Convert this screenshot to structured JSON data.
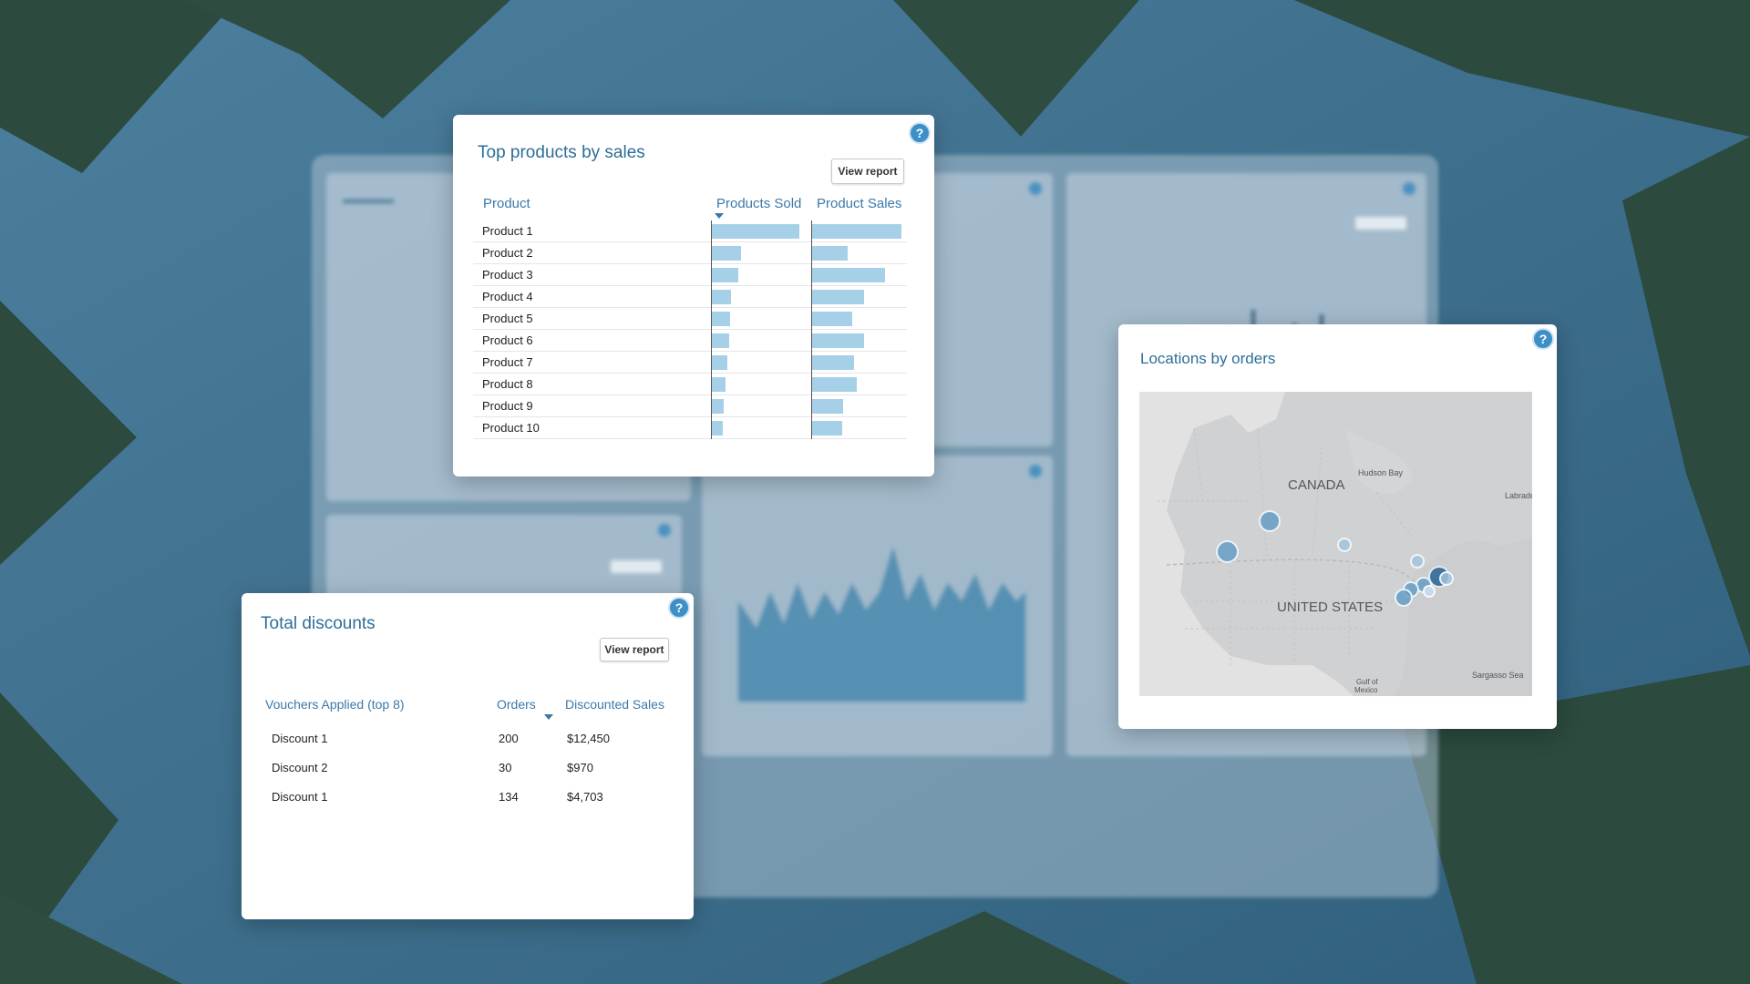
{
  "top_products": {
    "title": "Top products by sales",
    "view_report": "View report",
    "help": "?",
    "columns": {
      "product": "Product",
      "sold": "Products Sold",
      "sales": "Product Sales"
    },
    "rows": [
      {
        "name": "Product 1",
        "sold": 1.0,
        "sales": 1.0
      },
      {
        "name": "Product 2",
        "sold": 0.33,
        "sales": 0.4
      },
      {
        "name": "Product 3",
        "sold": 0.3,
        "sales": 0.82
      },
      {
        "name": "Product 4",
        "sold": 0.22,
        "sales": 0.58
      },
      {
        "name": "Product 5",
        "sold": 0.21,
        "sales": 0.45
      },
      {
        "name": "Product 6",
        "sold": 0.2,
        "sales": 0.58
      },
      {
        "name": "Product 7",
        "sold": 0.18,
        "sales": 0.47
      },
      {
        "name": "Product 8",
        "sold": 0.16,
        "sales": 0.5
      },
      {
        "name": "Product 9",
        "sold": 0.14,
        "sales": 0.35
      },
      {
        "name": "Product 10",
        "sold": 0.13,
        "sales": 0.34
      }
    ]
  },
  "total_discounts": {
    "title": "Total discounts",
    "view_report": "View report",
    "help": "?",
    "columns": {
      "voucher": "Vouchers Applied (top 8)",
      "orders": "Orders",
      "sales": "Discounted Sales"
    },
    "rows": [
      {
        "name": "Discount 1",
        "orders": "200",
        "sales": "$12,450"
      },
      {
        "name": "Discount 2",
        "orders": "30",
        "sales": "$970"
      },
      {
        "name": "Discount 1",
        "orders": "134",
        "sales": "$4,703"
      }
    ]
  },
  "locations": {
    "title": "Locations by orders",
    "help": "?",
    "labels": {
      "canada": "CANADA",
      "us": "UNITED STATES",
      "hudson": "Hudson Bay",
      "labrador": "Labrado",
      "gulf1": "Gulf of",
      "gulf2": "Mexico",
      "sargasso": "Sargasso Sea"
    }
  },
  "colors": {
    "accent": "#2d6e98",
    "bar": "#a6d0e8",
    "help": "#3c8fc7"
  }
}
